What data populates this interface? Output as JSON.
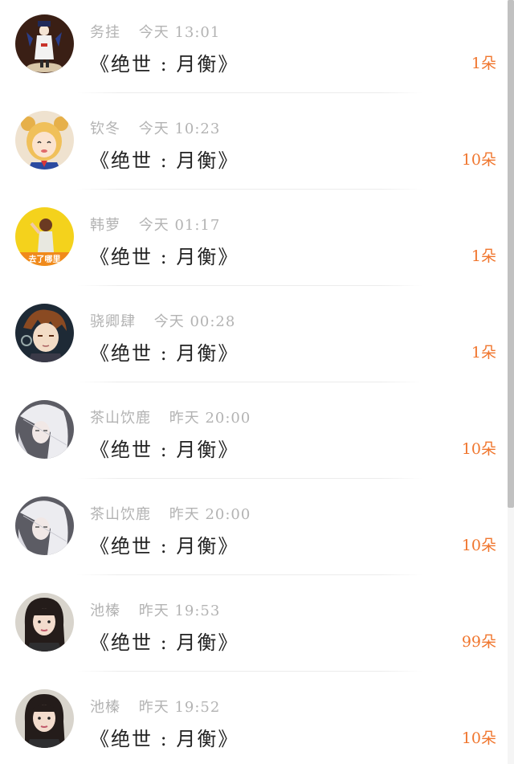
{
  "comments": [
    {
      "name": "务挂",
      "time": "今天 13:01",
      "title": "《绝世 : 月衡》",
      "count": "1朵",
      "avatar": "avatar-ninja-icon"
    },
    {
      "name": "钦冬",
      "time": "今天 10:23",
      "title": "《绝世 : 月衡》",
      "count": "10朵",
      "avatar": "avatar-anime-girl-icon"
    },
    {
      "name": "韩萝",
      "time": "今天 01:17",
      "title": "《绝世 : 月衡》",
      "count": "1朵",
      "avatar": "avatar-yellow-photo-icon"
    },
    {
      "name": "骁卿肆",
      "time": "今天 00:28",
      "title": "《绝世 : 月衡》",
      "count": "1朵",
      "avatar": "avatar-anime-boy-icon"
    },
    {
      "name": "茶山饮鹿",
      "time": "昨天 20:00",
      "title": "《绝世 : 月衡》",
      "count": "10朵",
      "avatar": "avatar-white-hair-icon"
    },
    {
      "name": "茶山饮鹿",
      "time": "昨天 20:00",
      "title": "《绝世 : 月衡》",
      "count": "10朵",
      "avatar": "avatar-white-hair-icon"
    },
    {
      "name": "池榛",
      "time": "昨天 19:53",
      "title": "《绝世 : 月衡》",
      "count": "99朵",
      "avatar": "avatar-woman-photo-icon"
    },
    {
      "name": "池榛",
      "time": "昨天 19:52",
      "title": "《绝世 : 月衡》",
      "count": "10朵",
      "avatar": "avatar-woman-photo-icon"
    }
  ],
  "avatar_overlay_text": "去了哪里",
  "colors": {
    "count": "#f0762e",
    "meta": "#b3b3b3",
    "title": "#222222"
  }
}
